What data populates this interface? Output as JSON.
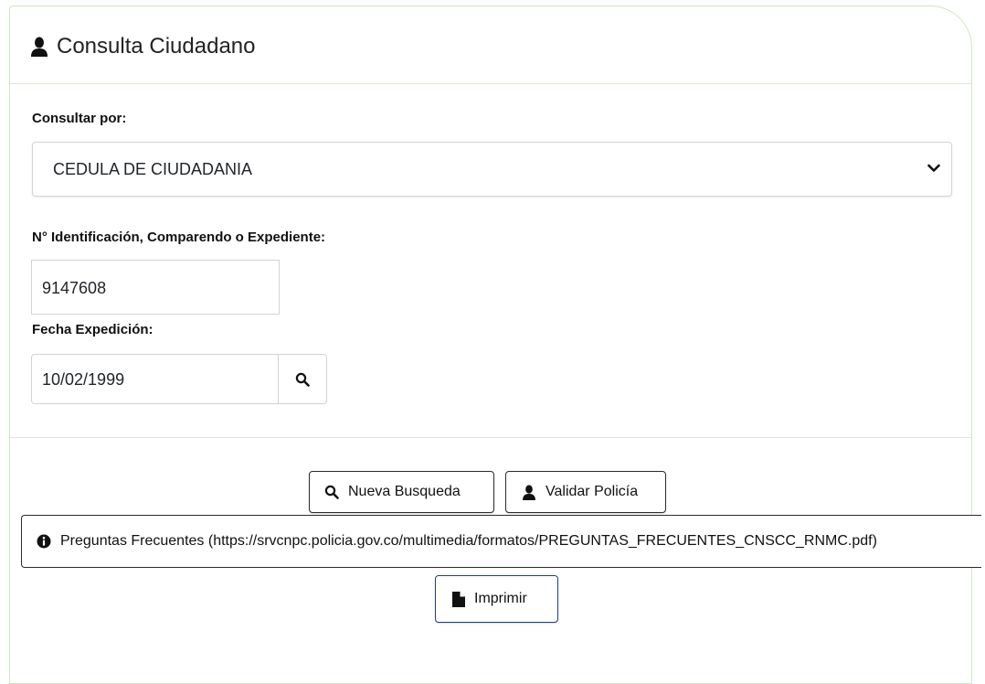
{
  "panel": {
    "title": "Consulta Ciudadano",
    "title_icon": "user-icon"
  },
  "form": {
    "consult_label": "Consultar por:",
    "consult_selected": "CEDULA DE CIUDADANIA",
    "id_label": "N° Identificación, Comparendo o Expediente:",
    "id_value": "9147608",
    "date_label": "Fecha Expedición:",
    "date_value": "10/02/1999",
    "search_icon": "search-icon"
  },
  "actions": {
    "new_search_label": "Nueva Busqueda",
    "validate_police_label": "Validar Policía",
    "faq_label": "Preguntas Frecuentes (https://srvcnpc.policia.gov.co/multimedia/formatos/PREGUNTAS_FRECUENTES_CNSCC_RNMC.pdf)",
    "print_label": "Imprimir"
  },
  "colors": {
    "panel_border": "#cfe6c4",
    "print_border": "#1f3f8f"
  }
}
